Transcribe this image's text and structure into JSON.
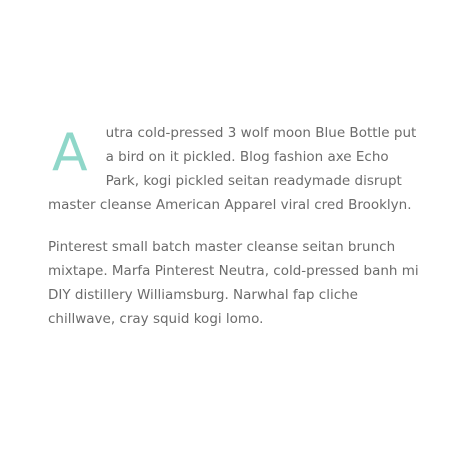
{
  "article": {
    "paragraphs": [
      {
        "dropcap": "A",
        "text": "utra cold-pressed 3 wolf moon Blue Bottle put a bird on it pickled. Blog fashion axe Echo Park, kogi pickled seitan readymade disrupt master cleanse American Apparel viral cred Brooklyn."
      },
      {
        "text": "Pinterest small batch master cleanse seitan brunch mixtape. Marfa Pinterest Neutra, cold-pressed banh mi DIY distillery Williamsburg. Narwhal fap cliche chillwave, cray squid kogi lomo."
      }
    ]
  },
  "colors": {
    "text": "#6b6b6b",
    "dropcap": "#8fd7c9",
    "background": "#ffffff"
  }
}
